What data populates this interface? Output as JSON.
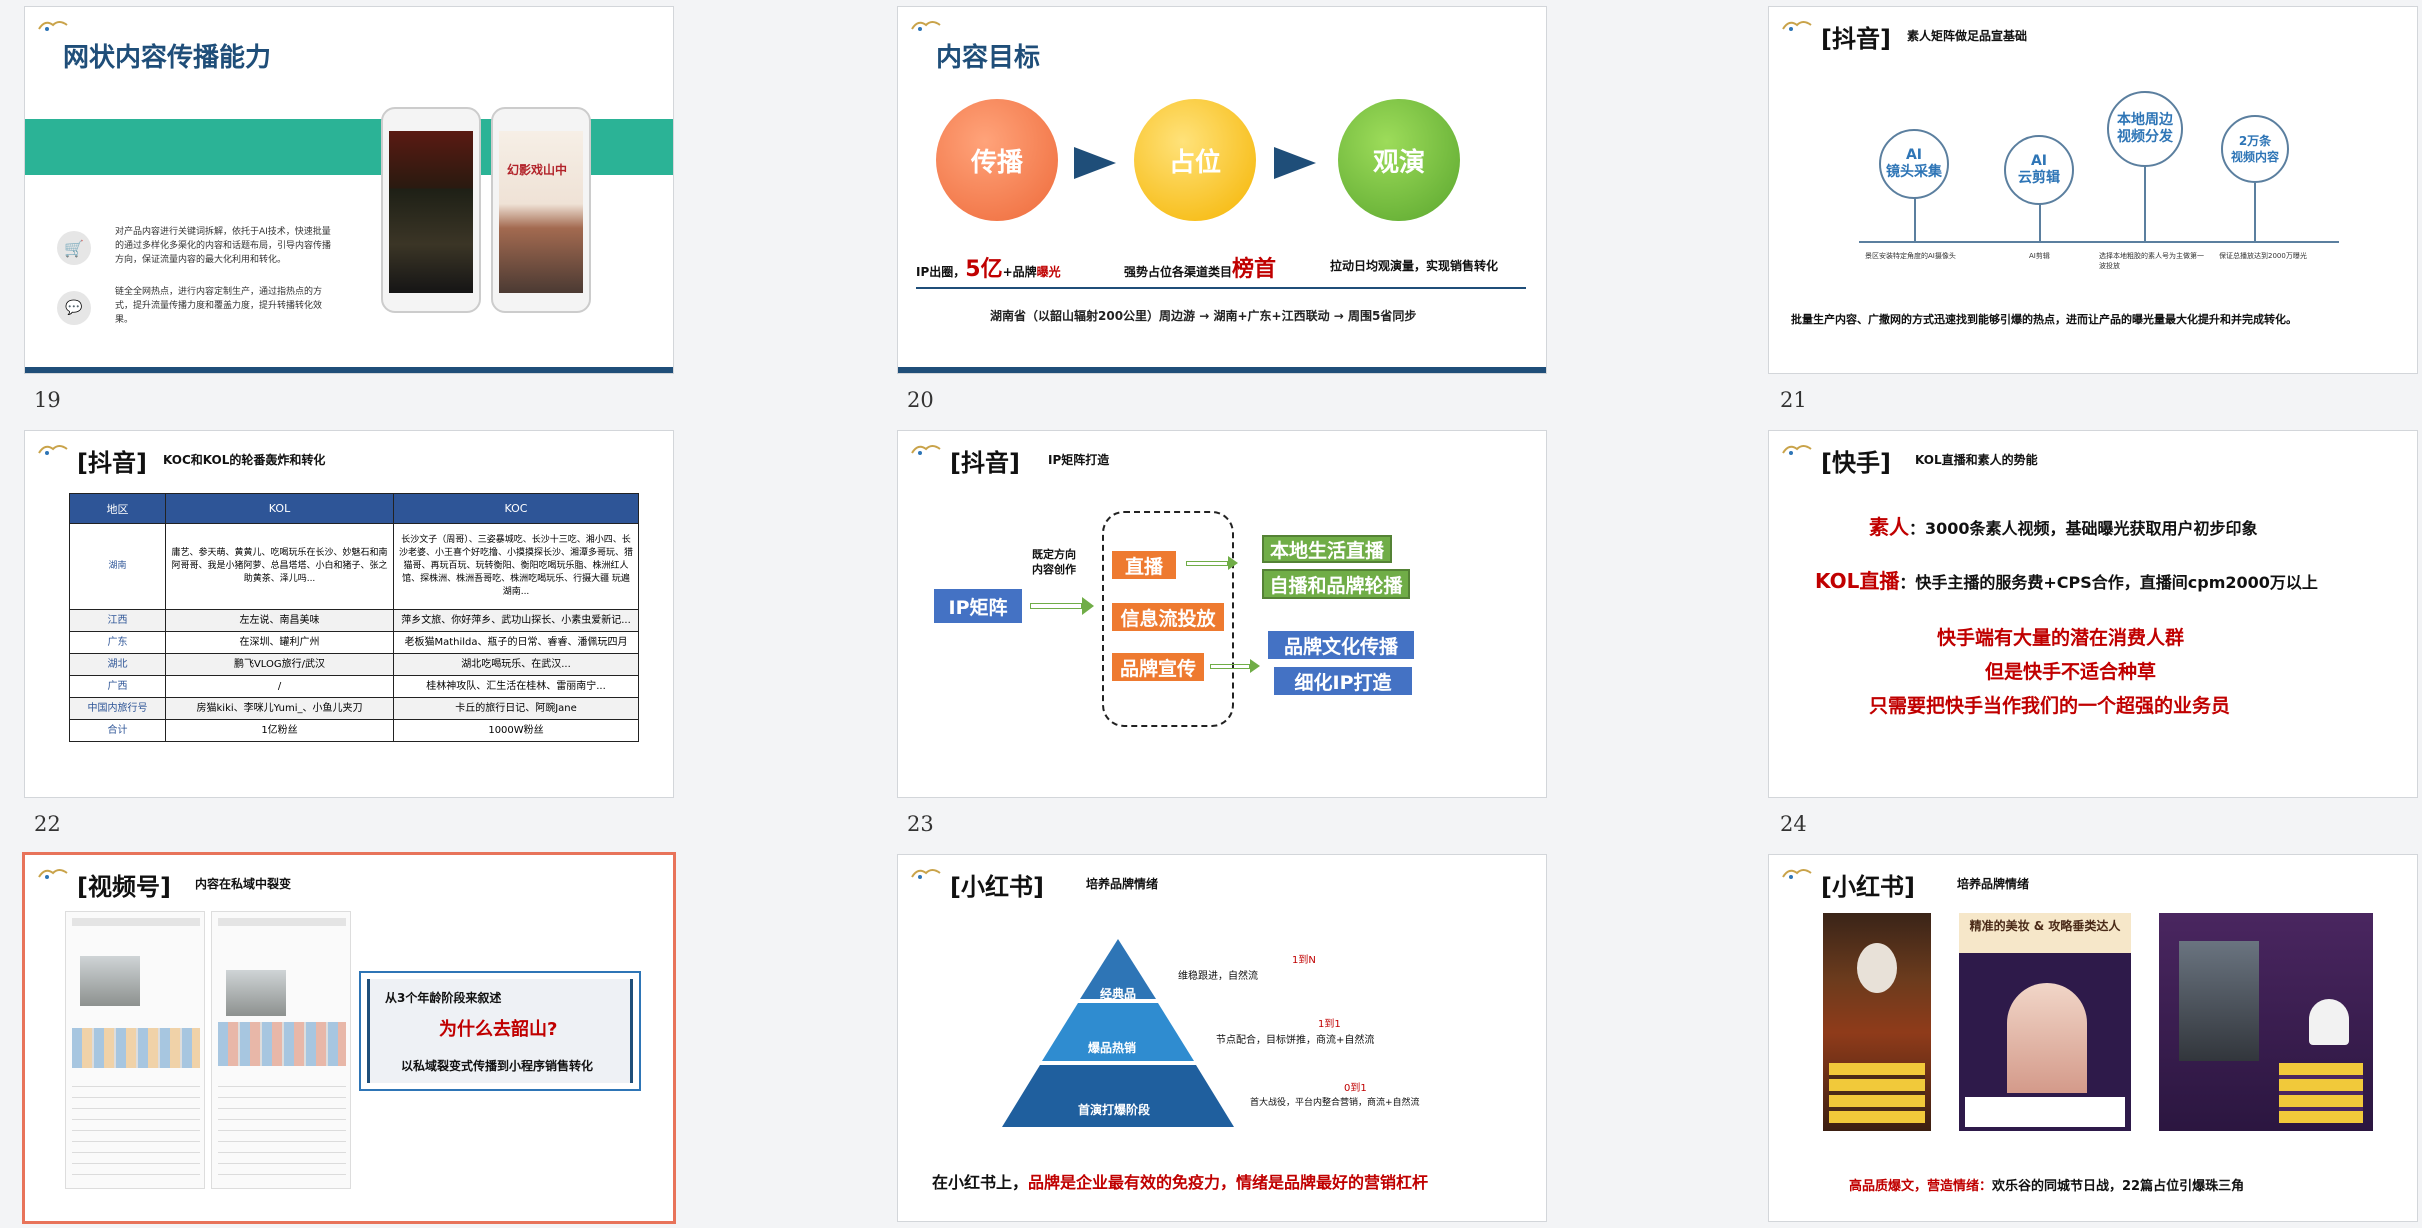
{
  "slide_numbers": [
    "19",
    "20",
    "21",
    "22",
    "23",
    "24"
  ],
  "s19": {
    "title": "网状内容传播能力",
    "text1": "对产品内容进行关键词拆解，依托于AI技术，快速批量的通过多样化多渠化的内容和话题布局，引导内容传播方向，保证流量内容的最大化利用和转化。",
    "text2": "链全全网热点，进行内容定制生产，通过指热点的方式，提升流量传播力度和覆盖力度，提升转播转化效果。",
    "phone2_text": "幻影戏山中"
  },
  "s20": {
    "title": "内容目标",
    "circles": [
      "传播",
      "占位",
      "观演"
    ],
    "c1_pre": "IP出圈，",
    "c1_big": "5亿",
    "c1_mid": "+品牌",
    "c1_red": "曝光",
    "c2_pre": "强势占位各渠道类目",
    "c2_big": "榜首",
    "c3": "拉动日均观演量，实现销售转化",
    "footer": "湖南省（以韶山辐射200公里）周边游 → 湖南+广东+江西联动 → 周围5省同步"
  },
  "s21": {
    "tag": "[抖音]",
    "subtitle": "素人矩阵做足品宣基础",
    "nodes": [
      "AI\n镜头采集",
      "AI\n云剪辑",
      "本地周边\n视频分发",
      "2万条\n视频内容"
    ],
    "captions": [
      "景区安装特定角度的AI摄像头",
      "AI剪辑",
      "选择本地粗胶的素人号为主做第一波投放",
      "保证总播放达到2000万曝光"
    ],
    "footer": "批量生产内容、广撒网的方式迅速找到能够引爆的热点，进而让产品的曝光量最大化提升和并完成转化。"
  },
  "s22": {
    "tag": "[抖音]",
    "subtitle": "KOC和KOL的轮番轰炸和转化",
    "headers": [
      "地区",
      "KOL",
      "KOC"
    ],
    "rows": [
      [
        "湖南",
        "庸艺、参天萌、黄黄儿、吃喝玩乐在长沙、妙魅石和南阿哥哥、我是小猪阿萝、总昌塔塔、小白和猪子、张之助黄茶、泽儿吗...",
        "长沙文子（周哥）、三姿暴城吃、长沙十三吃、湘小四、长沙老婆、小王喜个好吃撸、小摸摸探长沙、湘潭多哥玩、猎猫哥、再玩百玩、玩转衡阳、衡阳吃喝玩乐脂、株洲红人馆、探株洲、株洲吾哥吃、株洲吃喝玩乐、行摄大疆 玩遍湖南..."
      ],
      [
        "江西",
        "左左说、南昌美味",
        "萍乡文旅、你好萍乡、武功山探长、小素虫爱新记..."
      ],
      [
        "广东",
        "在深圳、罐利广州",
        "老板猫Mathilda、瓶子的日常、睿睿、潘佩玩四月"
      ],
      [
        "湖北",
        "鹏飞VLOG旅行/武汉",
        "湖北吃喝玩乐、在武汉..."
      ],
      [
        "广西",
        "/",
        "桂林神攻队、汇生活在桂林、雷丽南宁..."
      ],
      [
        "中国内旅行号",
        "房猫kiki、李咪儿Yumi_、小鱼儿夹刀",
        "卡丘的旅行日记、阿豌Jane"
      ],
      [
        "合计",
        "1亿粉丝",
        "1000W粉丝"
      ]
    ]
  },
  "s23": {
    "tag": "[抖音]",
    "subtitle": "IP矩阵打造",
    "ip": "IP矩阵",
    "direction": "既定方向\n内容创作",
    "orange": [
      "直播",
      "信息流投放",
      "品牌宣传"
    ],
    "green": [
      "本地生活直播",
      "自播和品牌轮播"
    ],
    "blue": [
      "品牌文化传播",
      "细化IP打造"
    ]
  },
  "s24": {
    "tag": "[快手]",
    "subtitle": "KOL直播和素人的势能",
    "l1_red": "素人",
    "l1_rest": "：3000条素人视频，基础曝光获取用户初步印象",
    "l2_red": "KOL直播",
    "l2_rest": "：快手主播的服务费+CPS合作，直播间cpm2000万以上",
    "l3": "快手端有大量的潜在消费人群",
    "l4": "但是快手不适合种草",
    "l5": "只需要把快手当作我们的一个超强的业务员"
  },
  "s25": {
    "tag": "[视频号]",
    "subtitle": "内容在私域中裂变",
    "box_l1": "从3个年龄阶段来叙述",
    "box_l2": "为什么去韶山?",
    "box_l3": "以私域裂变式传播到小程序销售转化"
  },
  "s26": {
    "tag": "[小红书]",
    "subtitle": "培养品牌情绪",
    "levels": [
      "经典品",
      "爆品热销",
      "首演打爆阶段"
    ],
    "ratios": [
      "1到N",
      "1到1",
      "0到1"
    ],
    "notes": [
      "维稳跟进，自然流",
      "节点配合，目标饼推，商流+自然流",
      "首大战役，平台内整合营销，商流+自然流"
    ],
    "footer_pre": "在小红书上，",
    "footer_red": "品牌是企业最有效的免疫力，情绪是品牌最好的营销杠杆"
  },
  "s27": {
    "tag": "[小红书]",
    "subtitle": "培养品牌情绪",
    "poster2": "精准的美妆 & 攻略垂类达人",
    "footer_red": "高品质爆文，营造情绪：",
    "footer_rest": "欢乐谷的同城节日战，22篇占位引爆珠三角"
  },
  "colors": {
    "navy": "#1f4e79",
    "teal": "#2bb396",
    "orange": "#ee7a30",
    "green": "#70ad47",
    "blue": "#4472c4",
    "red": "#c00000"
  }
}
